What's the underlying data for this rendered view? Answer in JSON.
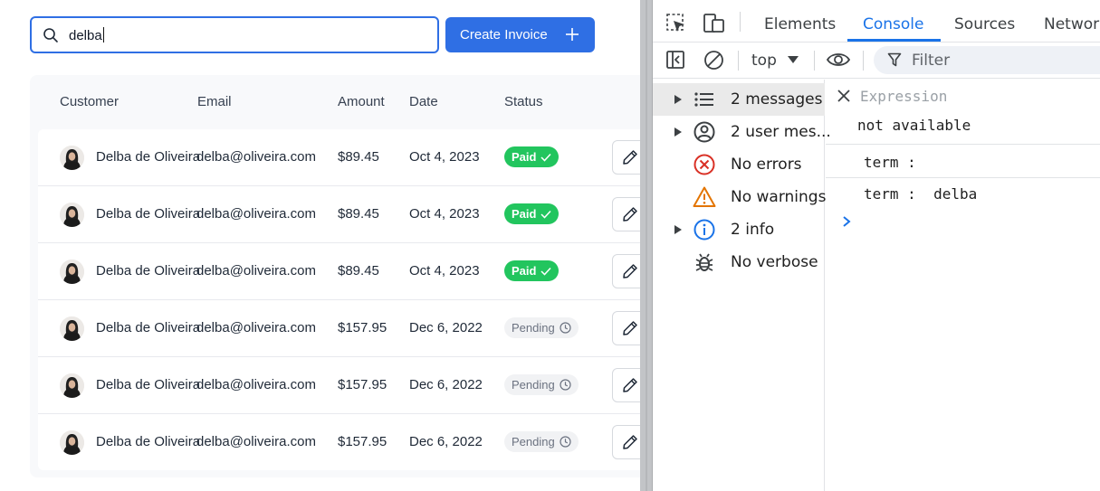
{
  "app": {
    "search": {
      "value": "delba",
      "placeholder": ""
    },
    "create_button": {
      "label": "Create Invoice"
    },
    "table": {
      "headers": [
        "Customer",
        "Email",
        "Amount",
        "Date",
        "Status"
      ],
      "rows": [
        {
          "name": "Delba de Oliveira",
          "email": "delba@oliveira.com",
          "amount": "$89.45",
          "date": "Oct 4, 2023",
          "status": "Paid"
        },
        {
          "name": "Delba de Oliveira",
          "email": "delba@oliveira.com",
          "amount": "$89.45",
          "date": "Oct 4, 2023",
          "status": "Paid"
        },
        {
          "name": "Delba de Oliveira",
          "email": "delba@oliveira.com",
          "amount": "$89.45",
          "date": "Oct 4, 2023",
          "status": "Paid"
        },
        {
          "name": "Delba de Oliveira",
          "email": "delba@oliveira.com",
          "amount": "$157.95",
          "date": "Dec 6, 2022",
          "status": "Pending"
        },
        {
          "name": "Delba de Oliveira",
          "email": "delba@oliveira.com",
          "amount": "$157.95",
          "date": "Dec 6, 2022",
          "status": "Pending"
        },
        {
          "name": "Delba de Oliveira",
          "email": "delba@oliveira.com",
          "amount": "$157.95",
          "date": "Dec 6, 2022",
          "status": "Pending"
        }
      ]
    },
    "colors": {
      "primary": "#2f6fe4",
      "paid": "#22c55e",
      "pending_bg": "#f1f2f4"
    }
  },
  "devtools": {
    "tabs": [
      "Elements",
      "Console",
      "Sources",
      "Network"
    ],
    "active_tab": "Console",
    "toolbar": {
      "context": "top",
      "filter_label": "Filter"
    },
    "sidebar": [
      {
        "label": "2 messages",
        "icon": "list-icon",
        "expandable": true,
        "selected": true
      },
      {
        "label": "2 user mes...",
        "icon": "user-icon",
        "expandable": true,
        "selected": false
      },
      {
        "label": "No errors",
        "icon": "error-icon",
        "expandable": false,
        "selected": false
      },
      {
        "label": "No warnings",
        "icon": "warning-icon",
        "expandable": false,
        "selected": false
      },
      {
        "label": "2 info",
        "icon": "info-icon",
        "expandable": true,
        "selected": false
      },
      {
        "label": "No verbose",
        "icon": "bug-icon",
        "expandable": false,
        "selected": false
      }
    ],
    "console": {
      "expression_placeholder": "Expression",
      "expression_value": "not available",
      "logs": [
        "term :",
        "term :  delba"
      ]
    },
    "colors": {
      "accent": "#1a73e8"
    }
  }
}
